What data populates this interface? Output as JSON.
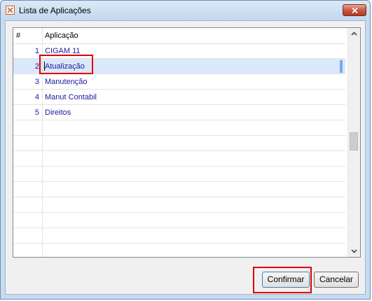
{
  "window": {
    "title": "Lista de Aplicações"
  },
  "grid": {
    "headers": {
      "number": "#",
      "application": "Aplicação"
    },
    "rows": [
      {
        "number": "1",
        "application": "CIGAM 11"
      },
      {
        "number": "2",
        "application": "Atualização"
      },
      {
        "number": "3",
        "application": "Manutenção"
      },
      {
        "number": "4",
        "application": "Manut Contabil"
      },
      {
        "number": "5",
        "application": "Direitos"
      }
    ],
    "selected_row": 2
  },
  "buttons": {
    "confirm": "Confirmar",
    "cancel": "Cancelar"
  },
  "colors": {
    "row_text": "#1a1a9e",
    "selection": "#dbe8fb",
    "highlight_box": "#e00000"
  }
}
